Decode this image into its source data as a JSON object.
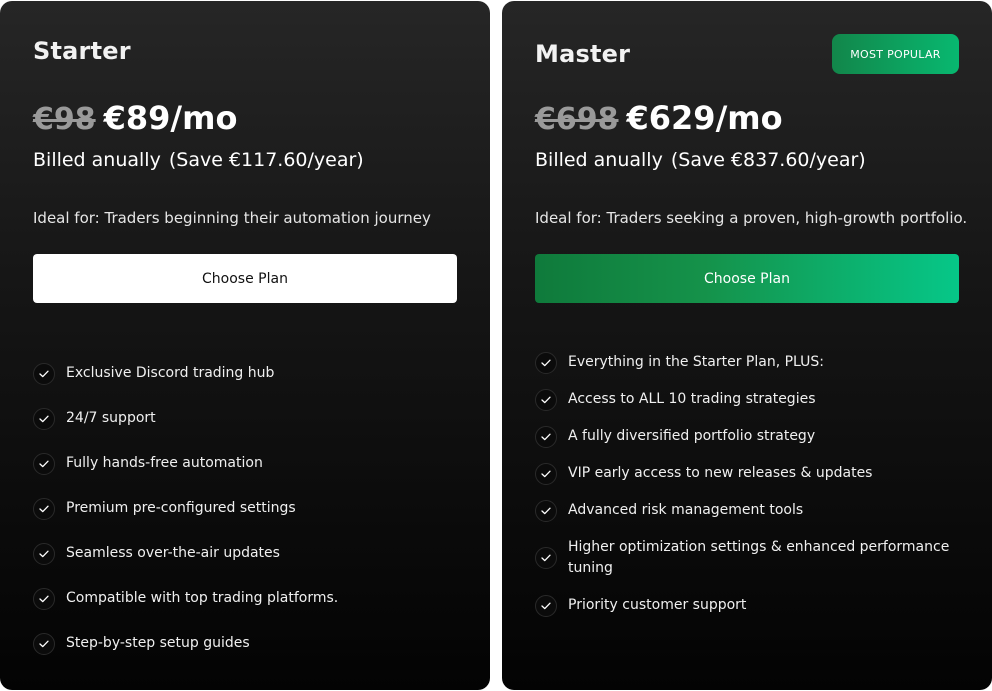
{
  "plans": [
    {
      "name": "Starter",
      "old_price": "€98",
      "new_price": "€89/mo",
      "billed": "Billed anually",
      "save": "(Save €117.60/year)",
      "ideal": "Ideal for: Traders beginning their automation journey",
      "cta": "Choose Plan",
      "features": [
        "Exclusive Discord trading hub",
        "24/7 support",
        "Fully hands-free automation",
        "Premium pre-configured settings",
        "Seamless over-the-air updates",
        "Compatible with top trading platforms.",
        "Step-by-step setup guides"
      ]
    },
    {
      "name": "Master",
      "badge": "MOST POPULAR",
      "old_price": "€698",
      "new_price": "€629/mo",
      "billed": "Billed anually",
      "save": "(Save €837.60/year)",
      "ideal": "Ideal for: Traders seeking a proven, high-growth portfolio.",
      "cta": "Choose Plan",
      "features": [
        "Everything in the Starter Plan, PLUS:",
        "Access to ALL 10 trading strategies",
        "A fully diversified portfolio strategy",
        "VIP early access to new releases & updates",
        "Advanced risk management tools",
        "Higher optimization settings & enhanced performance tuning",
        "Priority customer support"
      ]
    }
  ],
  "colors": {
    "accent_green": "#08b870",
    "card_bg_top": "#262626",
    "card_bg_bottom": "#030303"
  },
  "icons": {
    "feature_check": "check-icon"
  }
}
